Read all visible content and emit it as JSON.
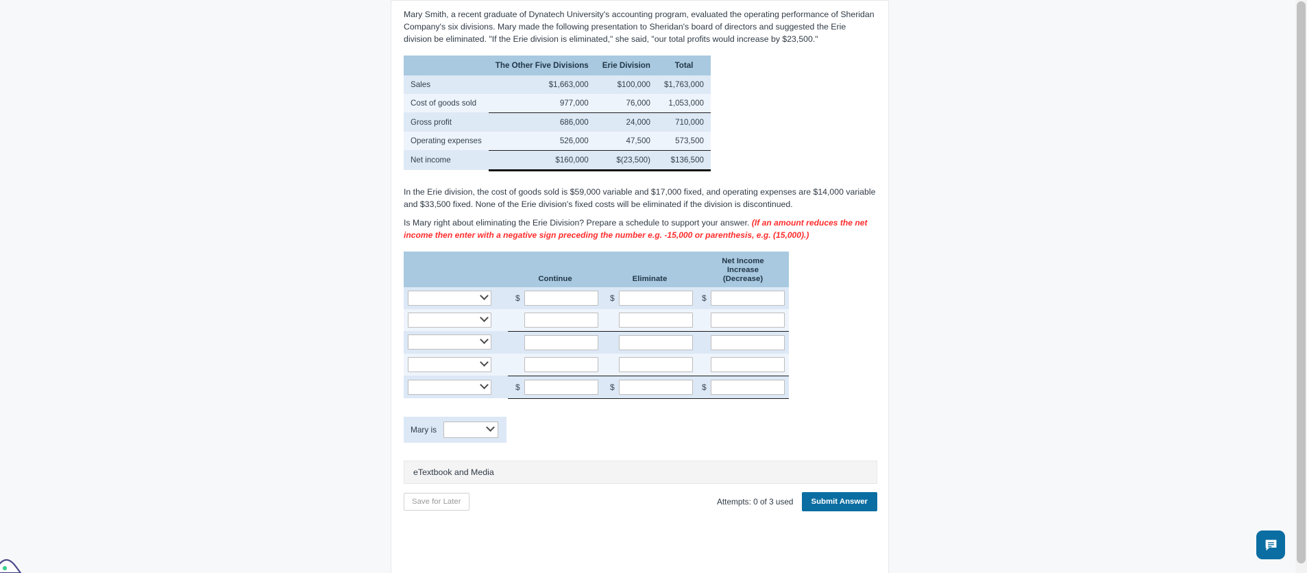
{
  "intro": {
    "paragraph": "Mary Smith, a recent graduate of Dynatech University's accounting program, evaluated the operating performance of Sheridan Company's six divisions. Mary made the following presentation to Sheridan's board of directors and suggested the Erie division be eliminated. \"If the Erie division is eliminated,\" she said, \"our total profits would increase by $23,500.\""
  },
  "presentation_table": {
    "headers": [
      "",
      "The Other Five Divisions",
      "Erie Division",
      "Total"
    ],
    "rows": [
      {
        "label": "Sales",
        "other": "$1,663,000",
        "erie": "$100,000",
        "total": "$1,763,000"
      },
      {
        "label": "Cost of goods sold",
        "other": "977,000",
        "erie": "76,000",
        "total": "1,053,000"
      },
      {
        "label": "Gross profit",
        "other": "686,000",
        "erie": "24,000",
        "total": "710,000"
      },
      {
        "label": "Operating expenses",
        "other": "526,000",
        "erie": "47,500",
        "total": "573,500"
      },
      {
        "label": "Net income",
        "other": "$160,000",
        "erie": "$(23,500)",
        "total": "$136,500"
      }
    ]
  },
  "detail": {
    "paragraph": "In the Erie division, the cost of goods sold is $59,000 variable and $17,000 fixed, and operating expenses are $14,000 variable and $33,500 fixed. None of the Erie division's fixed costs will be eliminated if the division is discontinued."
  },
  "question": {
    "prompt": "Is Mary right about eliminating the Erie Division? Prepare a schedule to support your answer.",
    "note": "(If an amount reduces the net income then enter with a negative sign preceding the number e.g. -15,000 or parenthesis, e.g. (15,000).)"
  },
  "answer_table": {
    "headers": {
      "label": "",
      "continue": "Continue",
      "eliminate": "Eliminate",
      "net_income": "Net Income Increase (Decrease)",
      "net_income_line1": "Net Income",
      "net_income_line2": "Increase",
      "net_income_line3": "(Decrease)"
    },
    "select_placeholder": "",
    "rows": [
      {
        "select_value": "",
        "continue_value": "",
        "eliminate_value": "",
        "net_income_value": "",
        "show_dollar": true,
        "underline": "none"
      },
      {
        "select_value": "",
        "continue_value": "",
        "eliminate_value": "",
        "net_income_value": "",
        "show_dollar": false,
        "underline": "single"
      },
      {
        "select_value": "",
        "continue_value": "",
        "eliminate_value": "",
        "net_income_value": "",
        "show_dollar": false,
        "underline": "none"
      },
      {
        "select_value": "",
        "continue_value": "",
        "eliminate_value": "",
        "net_income_value": "",
        "show_dollar": false,
        "underline": "single"
      },
      {
        "select_value": "",
        "continue_value": "",
        "eliminate_value": "",
        "net_income_value": "",
        "show_dollar": true,
        "underline": "bottom"
      }
    ]
  },
  "conclusion": {
    "label": "Mary is",
    "select_value": ""
  },
  "footer": {
    "etextbook_label": "eTextbook and Media",
    "save_label": "Save for Later",
    "attempts_label": "Attempts: 0 of 3 used",
    "submit_label": "Submit Answer"
  },
  "colors": {
    "header_blue": "#a8c9e0",
    "row_odd": "#dde9f5",
    "row_even": "#eef4fb",
    "accent": "#0b6ea2",
    "note_red": "#ff2d2d"
  }
}
